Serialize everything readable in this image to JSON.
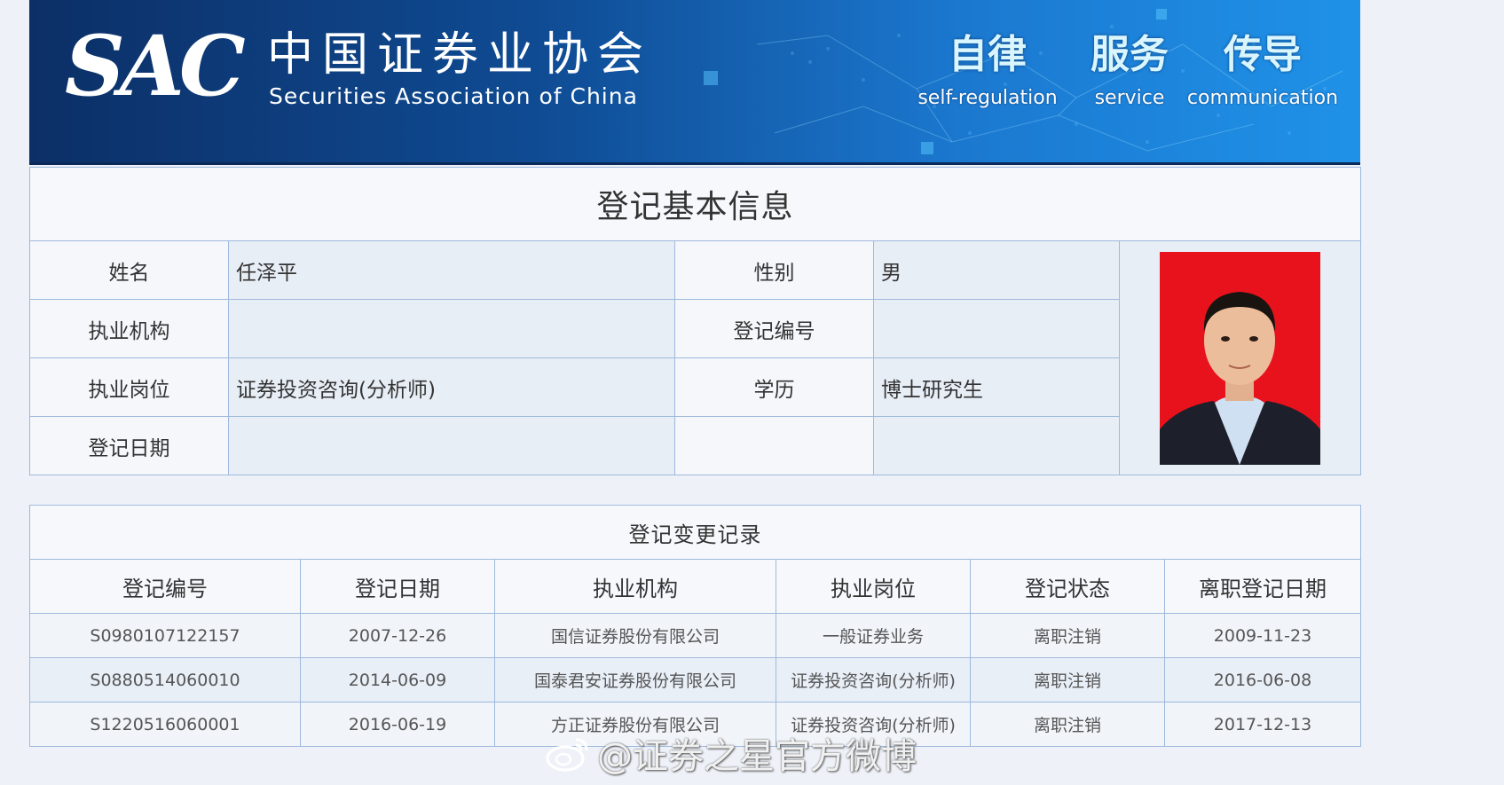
{
  "banner": {
    "logo": "SAC",
    "org_name_cn": "中国证券业协会",
    "org_name_en": "Securities Association of China",
    "slogans": [
      {
        "zh": "自律",
        "en": "self-regulation"
      },
      {
        "zh": "服务",
        "en": "service"
      },
      {
        "zh": "传导",
        "en": "communication"
      }
    ]
  },
  "basic_info": {
    "title": "登记基本信息",
    "rows": [
      {
        "l1": "姓名",
        "v1": "任泽平",
        "l2": "性别",
        "v2": "男"
      },
      {
        "l1": "执业机构",
        "v1": "",
        "l2": "登记编号",
        "v2": ""
      },
      {
        "l1": "执业岗位",
        "v1": "证券投资咨询(分析师)",
        "l2": "学历",
        "v2": "博士研究生"
      },
      {
        "l1": "登记日期",
        "v1": "",
        "l2": "",
        "v2": ""
      }
    ]
  },
  "records": {
    "title": "登记变更记录",
    "headers": [
      "登记编号",
      "登记日期",
      "执业机构",
      "执业岗位",
      "登记状态",
      "离职登记日期"
    ],
    "rows": [
      [
        "S0980107122157",
        "2007-12-26",
        "国信证券股份有限公司",
        "一般证券业务",
        "离职注销",
        "2009-11-23"
      ],
      [
        "S0880514060010",
        "2014-06-09",
        "国泰君安证券股份有限公司",
        "证券投资咨询(分析师)",
        "离职注销",
        "2016-06-08"
      ],
      [
        "S1220516060001",
        "2016-06-19",
        "方正证券股份有限公司",
        "证券投资咨询(分析师)",
        "离职注销",
        "2017-12-13"
      ]
    ]
  },
  "watermark": "@证券之星官方微博",
  "colors": {
    "banner_dark": "#0c2f66",
    "banner_light": "#1f92e8",
    "photo_bg": "#e8121c",
    "border": "#9fb9dd"
  }
}
